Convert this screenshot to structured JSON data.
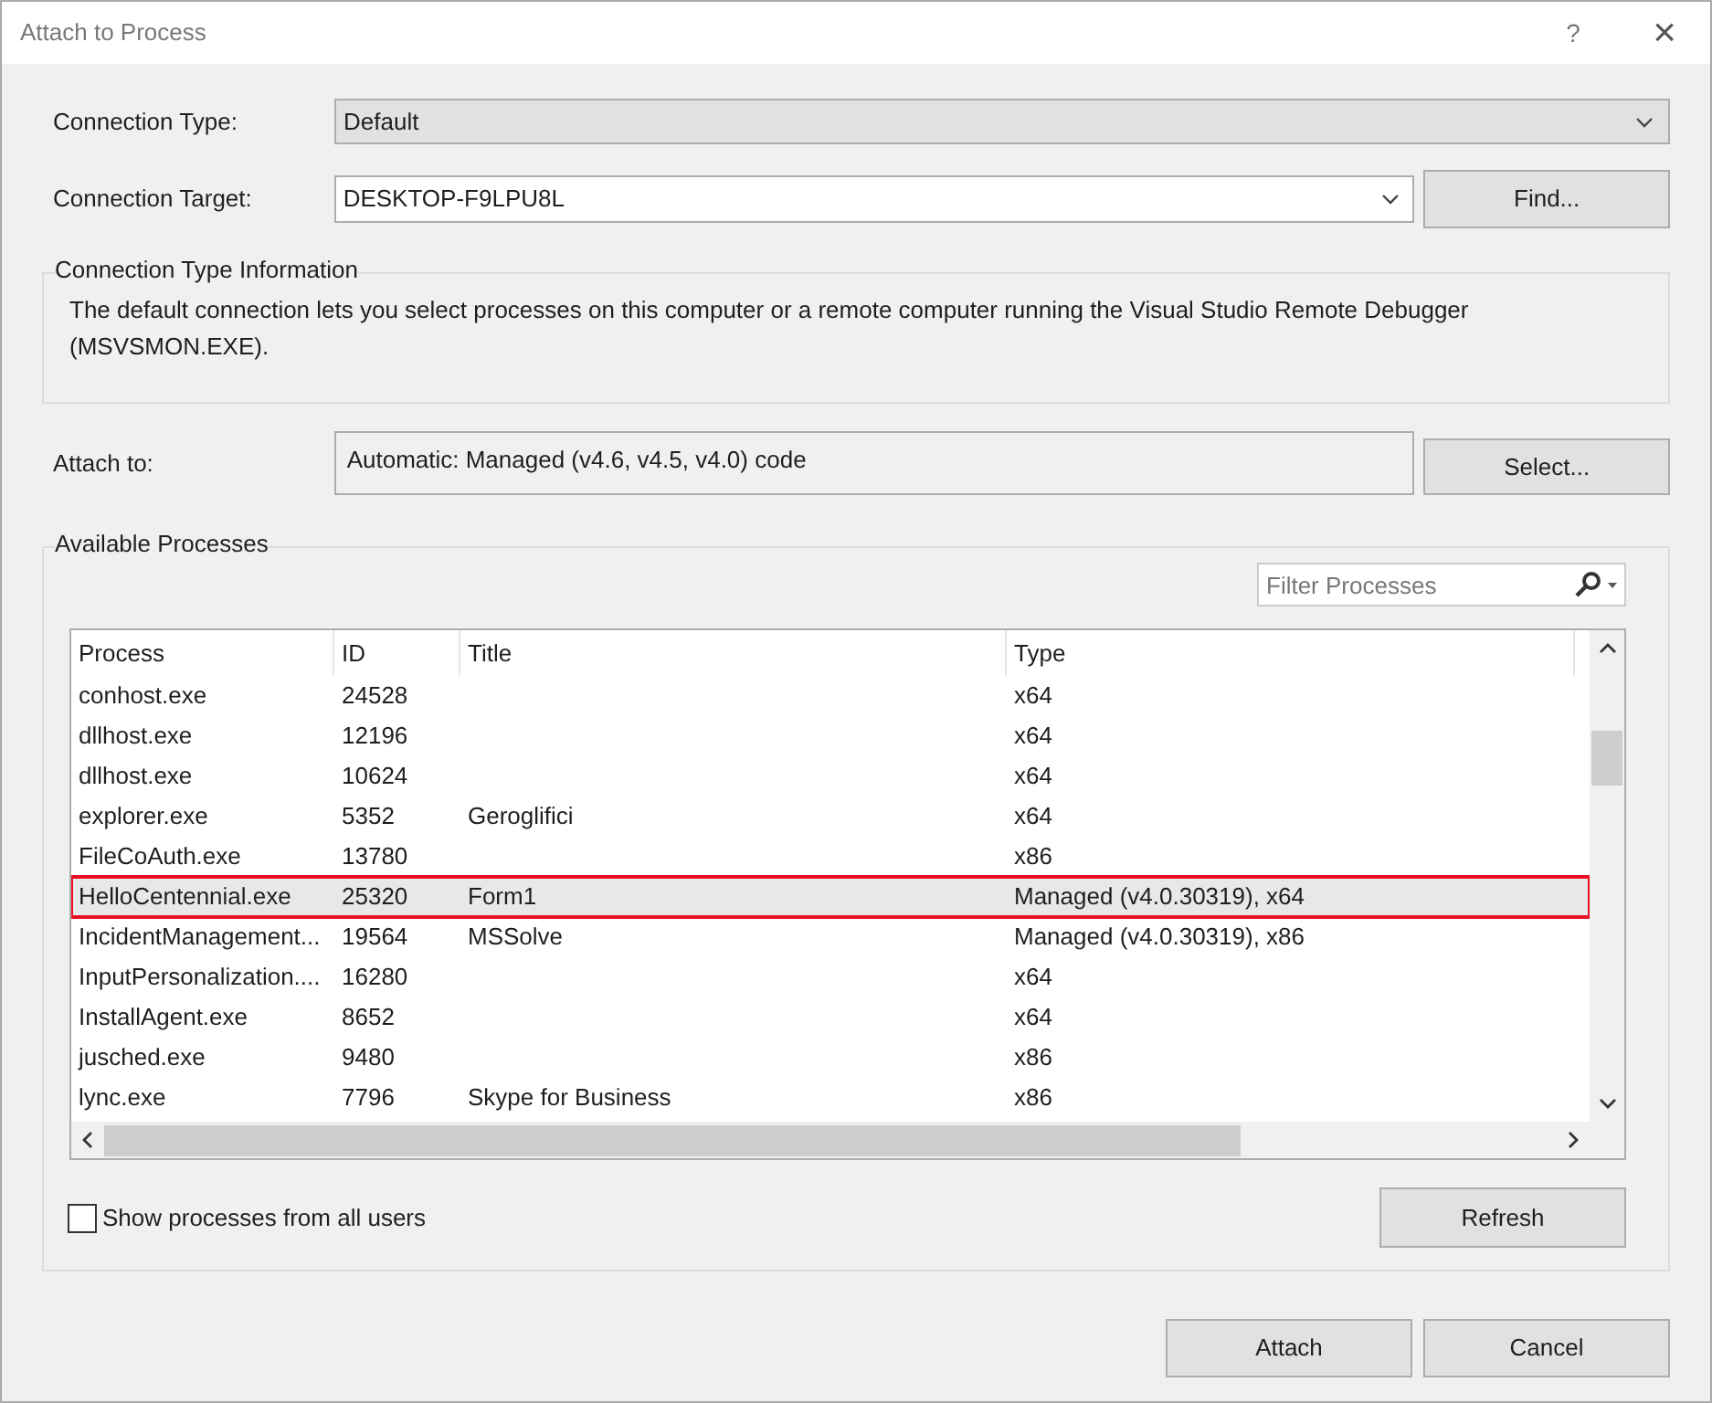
{
  "window": {
    "title": "Attach to Process",
    "help": "?",
    "close": "×"
  },
  "connection_type": {
    "label": "Connection Type:",
    "value": "Default"
  },
  "connection_target": {
    "label": "Connection Target:",
    "value": "DESKTOP-F9LPU8L",
    "button": "Find..."
  },
  "info": {
    "title": "Connection Type Information",
    "text": "The default connection lets you select processes on this computer or a remote computer running the Visual Studio Remote Debugger (MSVSMON.EXE)."
  },
  "attach_to": {
    "label": "Attach to:",
    "value": "Automatic: Managed (v4.6, v4.5, v4.0) code",
    "button": "Select..."
  },
  "processes": {
    "title": "Available Processes",
    "filter": {
      "placeholder": "Filter Processes"
    },
    "columns": [
      "Process",
      "ID",
      "Title",
      "Type"
    ],
    "rows": [
      {
        "cells": [
          "conhost.exe",
          "24528",
          "",
          "x64"
        ],
        "selected": false
      },
      {
        "cells": [
          "dllhost.exe",
          "12196",
          "",
          "x64"
        ],
        "selected": false
      },
      {
        "cells": [
          "dllhost.exe",
          "10624",
          "",
          "x64"
        ],
        "selected": false
      },
      {
        "cells": [
          "explorer.exe",
          "5352",
          "Geroglifici",
          "x64"
        ],
        "selected": false
      },
      {
        "cells": [
          "FileCoAuth.exe",
          "13780",
          "",
          "x86"
        ],
        "selected": false
      },
      {
        "cells": [
          "HelloCentennial.exe",
          "25320",
          "Form1",
          "Managed (v4.0.30319), x64"
        ],
        "selected": true
      },
      {
        "cells": [
          "IncidentManagement...",
          "19564",
          "MSSolve",
          "Managed (v4.0.30319), x86"
        ],
        "selected": false
      },
      {
        "cells": [
          "InputPersonalization....",
          "16280",
          "",
          "x64"
        ],
        "selected": false
      },
      {
        "cells": [
          "InstallAgent.exe",
          "8652",
          "",
          "x64"
        ],
        "selected": false
      },
      {
        "cells": [
          "jusched.exe",
          "9480",
          "",
          "x86"
        ],
        "selected": false
      },
      {
        "cells": [
          "lync.exe",
          "7796",
          "Skype for Business",
          "x86"
        ],
        "selected": false
      }
    ],
    "show_all_users": {
      "label": "Show processes from all users",
      "checked": false
    },
    "refresh": "Refresh"
  },
  "buttons": [
    "Attach",
    "Cancel"
  ]
}
